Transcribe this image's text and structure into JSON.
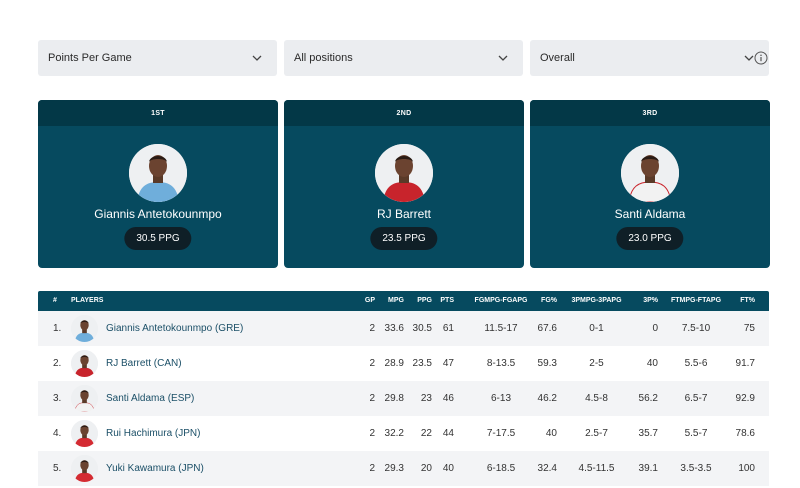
{
  "filters": [
    {
      "label": "Points Per Game"
    },
    {
      "label": "All positions"
    },
    {
      "label": "Overall"
    }
  ],
  "top3": [
    {
      "rank": "1ST",
      "name": "Giannis Antetokounmpo",
      "ppg": "30.5 PPG",
      "jersey_color": "#6faedb"
    },
    {
      "rank": "2ND",
      "name": "RJ Barrett",
      "ppg": "23.5 PPG",
      "jersey_color": "#c8242c"
    },
    {
      "rank": "3RD",
      "name": "Santi Aldama",
      "ppg": "23.0 PPG",
      "jersey_color": "#f2f2f2"
    }
  ],
  "table": {
    "headers": {
      "num": "#",
      "players": "PLAYERS",
      "gp": "GP",
      "mpg": "MPG",
      "ppg": "PPG",
      "pts": "PTS",
      "fg": "FGMPG-FGAPG",
      "fgp": "FG%",
      "tp": "3PMPG-3PAPG",
      "tpp": "3P%",
      "ft": "FTMPG-FTAPG",
      "ftp": "FT%"
    },
    "rows": [
      {
        "num": "1.",
        "name": "Giannis Antetokounmpo (GRE)",
        "gp": "2",
        "mpg": "33.6",
        "ppg": "30.5",
        "pts": "61",
        "fg": "11.5-17",
        "fgp": "67.6",
        "tp": "0-1",
        "tpp": "0",
        "ft": "7.5-10",
        "ftp": "75",
        "jersey_color": "#6faedb"
      },
      {
        "num": "2.",
        "name": "RJ Barrett (CAN)",
        "gp": "2",
        "mpg": "28.9",
        "ppg": "23.5",
        "pts": "47",
        "fg": "8-13.5",
        "fgp": "59.3",
        "tp": "2-5",
        "tpp": "40",
        "ft": "5.5-6",
        "ftp": "91.7",
        "jersey_color": "#c8242c"
      },
      {
        "num": "3.",
        "name": "Santi Aldama (ESP)",
        "gp": "2",
        "mpg": "29.8",
        "ppg": "23",
        "pts": "46",
        "fg": "6-13",
        "fgp": "46.2",
        "tp": "4.5-8",
        "tpp": "56.2",
        "ft": "6.5-7",
        "ftp": "92.9",
        "jersey_color": "#f2f2f2"
      },
      {
        "num": "4.",
        "name": "Rui Hachimura (JPN)",
        "gp": "2",
        "mpg": "32.2",
        "ppg": "22",
        "pts": "44",
        "fg": "7-17.5",
        "fgp": "40",
        "tp": "2.5-7",
        "tpp": "35.7",
        "ft": "5.5-7",
        "ftp": "78.6",
        "jersey_color": "#d42b32"
      },
      {
        "num": "5.",
        "name": "Yuki Kawamura (JPN)",
        "gp": "2",
        "mpg": "29.3",
        "ppg": "20",
        "pts": "40",
        "fg": "6-18.5",
        "fgp": "32.4",
        "tp": "4.5-11.5",
        "tpp": "39.1",
        "ft": "3.5-3.5",
        "ftp": "100",
        "jersey_color": "#d42b32"
      }
    ]
  },
  "icons": {
    "dropdown": "chevron-down-icon",
    "info": "info-icon",
    "avatar": "player-avatar"
  },
  "colors": {
    "card_bg": "#064a5f",
    "card_header": "#033847",
    "pill_bg": "#0f1f27",
    "name_link": "#1b4f67"
  }
}
